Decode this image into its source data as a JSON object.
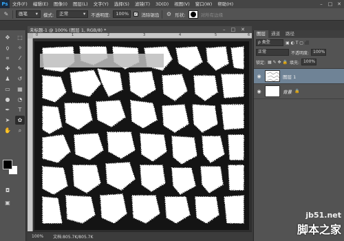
{
  "app": {
    "logo": "Ps"
  },
  "menu": [
    "文件(F)",
    "编辑(E)",
    "图像(I)",
    "图层(L)",
    "文字(Y)",
    "选择(S)",
    "滤镜(T)",
    "3D(D)",
    "视图(V)",
    "窗口(W)",
    "帮助(H)"
  ],
  "window_buttons": {
    "minimize": "–",
    "restore": "□",
    "close": "✕"
  },
  "options": {
    "brush_preset": "画笔",
    "mode_label": "模式:",
    "mode_value": "正常",
    "opacity_label": "不透明度:",
    "opacity_value": "100%",
    "antialias_label": "消除锯齿",
    "shape_label": "形状:",
    "edge_label": "对所有边缘"
  },
  "document": {
    "tab_title": "未标题-1 @ 100% (图层 1, RGB/8) *",
    "zoom": "100%",
    "doc_info": "文档:805.7K/805.7K",
    "ruler_ticks": [
      "0",
      "1",
      "2",
      "3",
      "4",
      "5",
      "6"
    ]
  },
  "panels": {
    "tabs": [
      "图层",
      "通道",
      "路径"
    ],
    "kind_label": "ρ 类型",
    "blend_mode": "正常",
    "opacity_label": "不透明度:",
    "opacity_value": "100%",
    "lock_label": "锁定:",
    "fill_label": "填充:",
    "fill_value": "100%",
    "layers": [
      {
        "name": "图层 1",
        "selected": true
      },
      {
        "name": "背景",
        "selected": false
      }
    ]
  },
  "colors": {
    "foreground": "#000000",
    "background": "#ffffff",
    "selected_layer": "#6f8396"
  },
  "watermark": {
    "url": "jb51.net",
    "text": "脚本之家"
  }
}
